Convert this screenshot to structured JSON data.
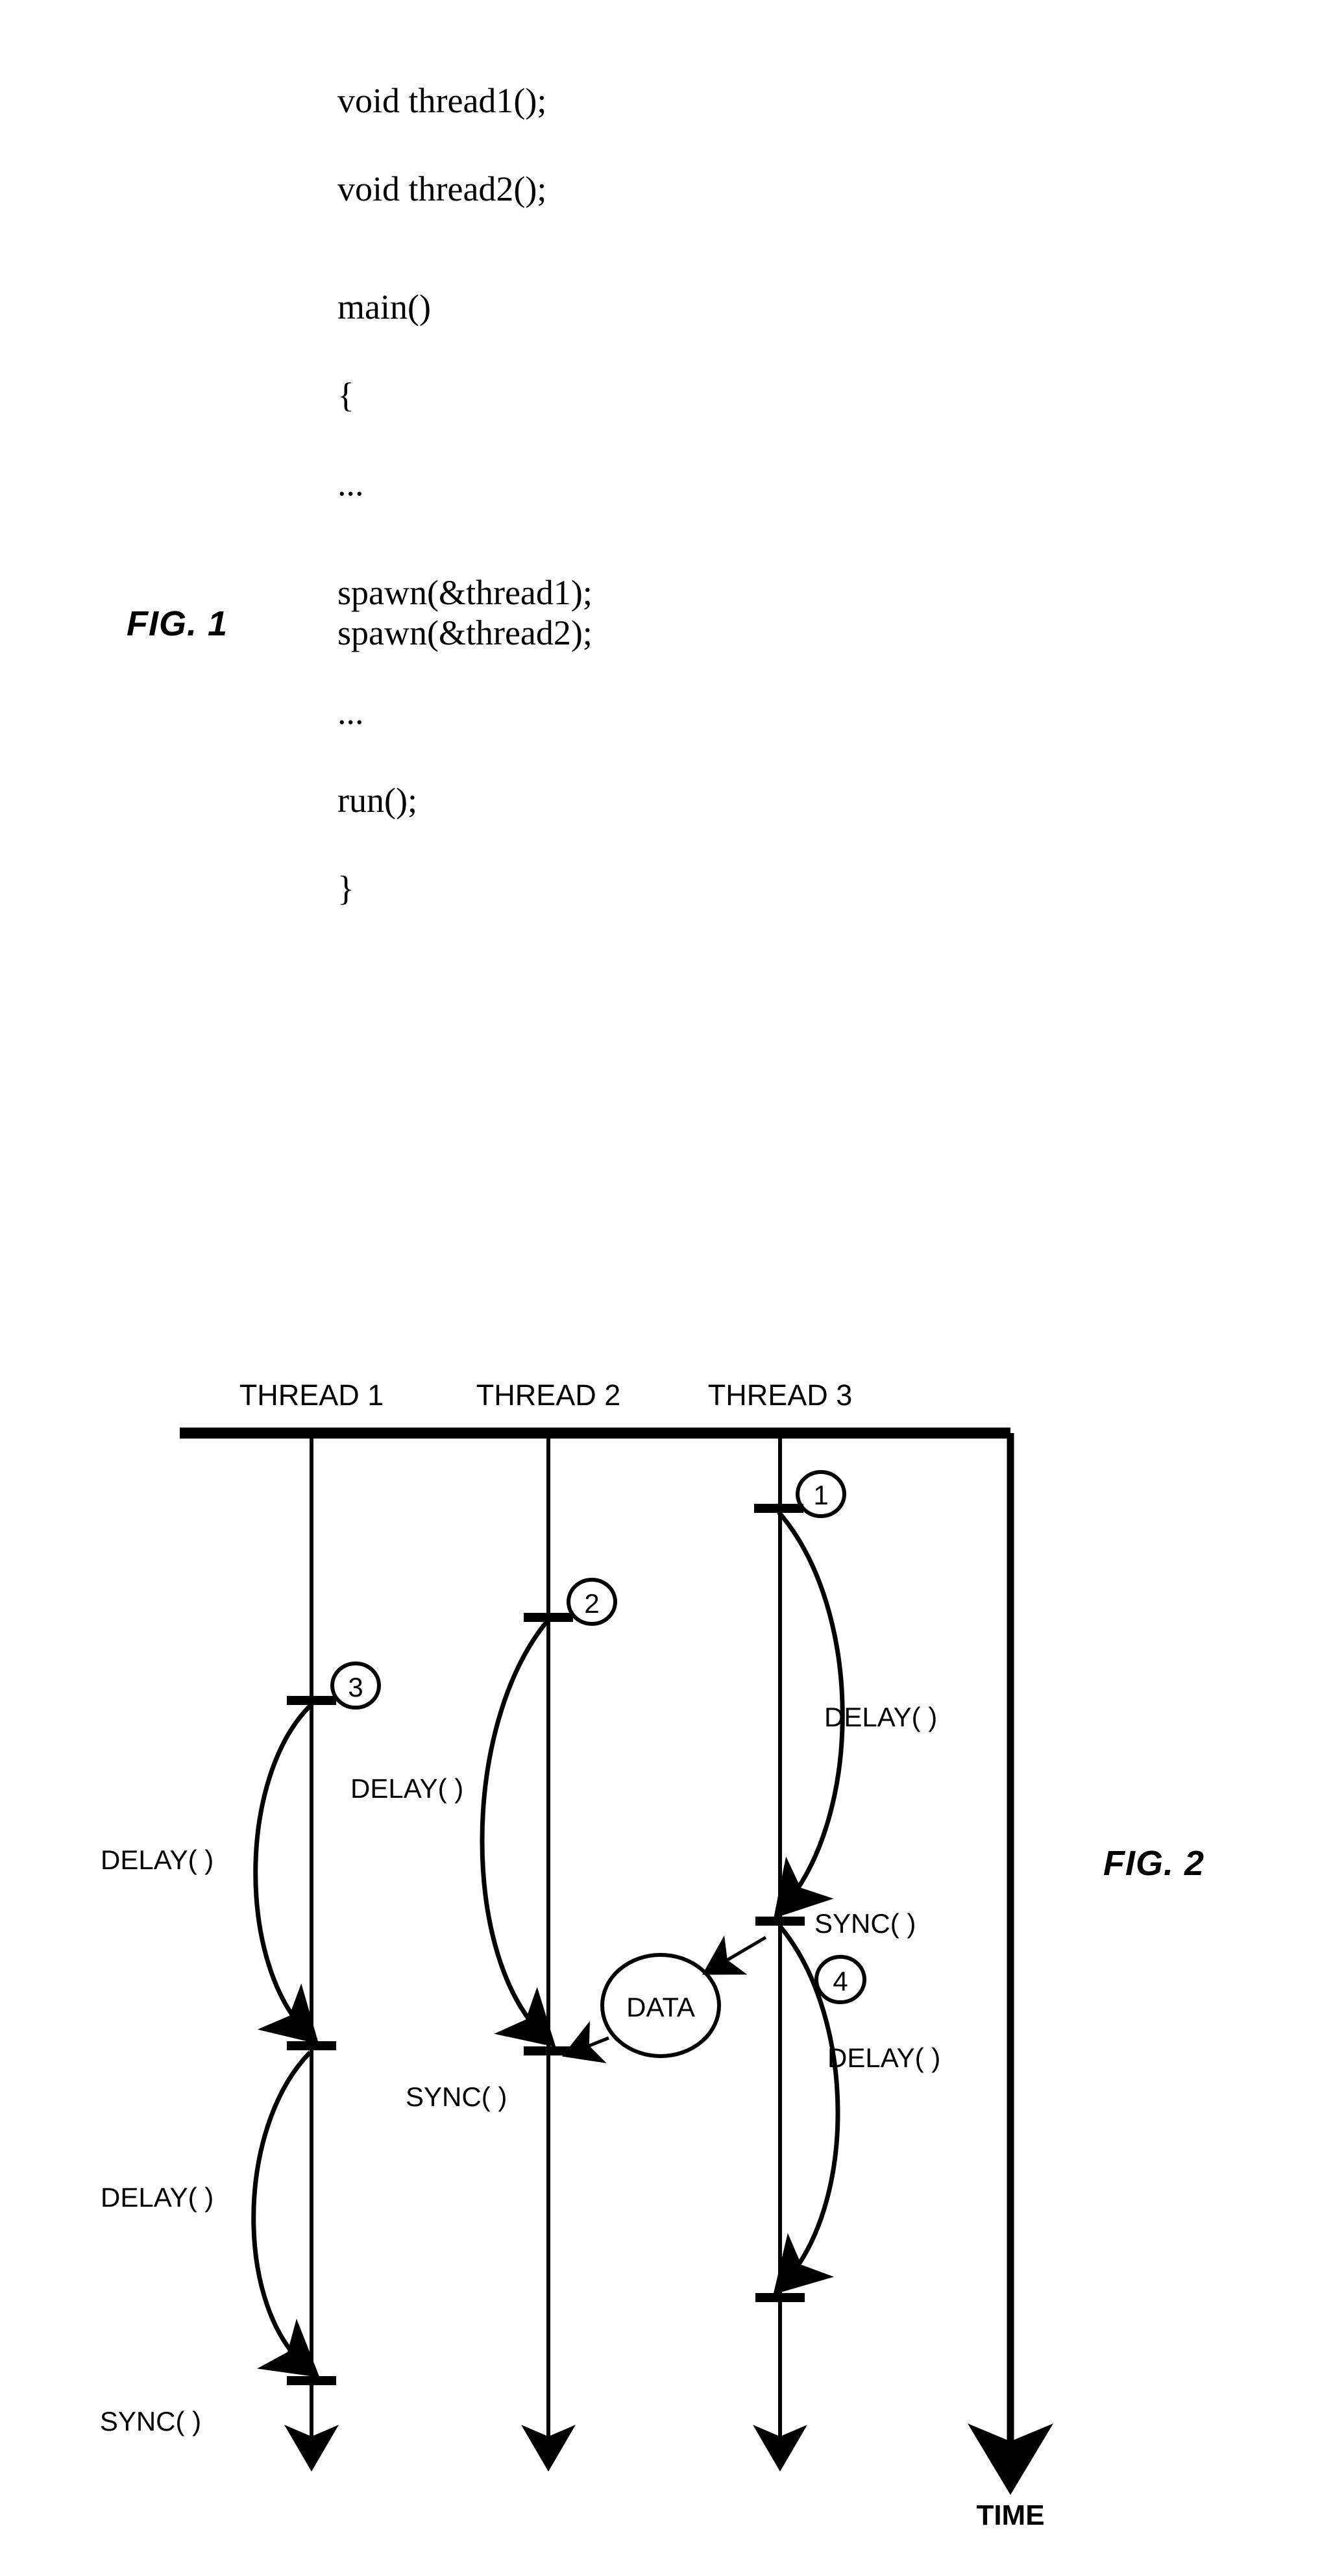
{
  "figure1": {
    "label": "FIG. 1",
    "code_lines": [
      "void thread1();",
      "void thread2();",
      "main()",
      "{",
      "...",
      "spawn(&thread1);",
      "spawn(&thread2);",
      "...",
      "run();",
      "}"
    ]
  },
  "figure2": {
    "label": "FIG. 2",
    "time_axis_label": "TIME",
    "thread_headers": [
      "THREAD 1",
      "THREAD 2",
      "THREAD 3"
    ],
    "data_bubble": "DATA",
    "call_labels": {
      "delay": "DELAY( )",
      "sync": "SYNC( )"
    },
    "step_markers": [
      "1",
      "2",
      "3",
      "4"
    ],
    "annotations": [
      {
        "id": "t3-marker-1",
        "text": "1",
        "thread": "THREAD 3"
      },
      {
        "id": "t3-delay-1",
        "text": "DELAY( )",
        "thread": "THREAD 3"
      },
      {
        "id": "t2-marker-2",
        "text": "2",
        "thread": "THREAD 2"
      },
      {
        "id": "t2-delay-1",
        "text": "DELAY( )",
        "thread": "THREAD 2"
      },
      {
        "id": "t1-marker-3",
        "text": "3",
        "thread": "THREAD 1"
      },
      {
        "id": "t1-delay-1",
        "text": "DELAY( )",
        "thread": "THREAD 1"
      },
      {
        "id": "t1-delay-2",
        "text": "DELAY( )",
        "thread": "THREAD 1"
      },
      {
        "id": "t1-sync-1",
        "text": "SYNC( )",
        "thread": "THREAD 1"
      },
      {
        "id": "t2-sync-1",
        "text": "SYNC( )",
        "thread": "THREAD 2"
      },
      {
        "id": "t3-sync-1",
        "text": "SYNC( )",
        "thread": "THREAD 3"
      },
      {
        "id": "t3-marker-4",
        "text": "4",
        "thread": "THREAD 3"
      },
      {
        "id": "t3-delay-2",
        "text": "DELAY( )",
        "thread": "THREAD 3"
      },
      {
        "id": "data-bubble",
        "text": "DATA",
        "thread": "shared"
      }
    ]
  }
}
